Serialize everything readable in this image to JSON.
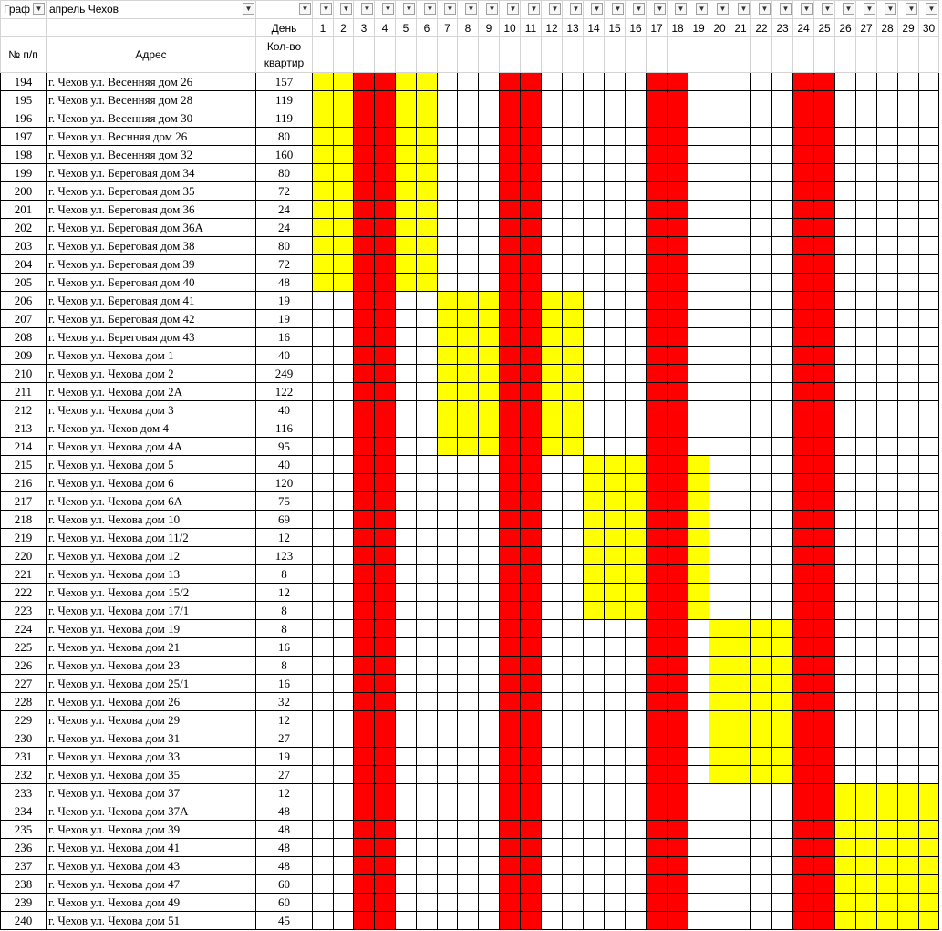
{
  "filter_row": {
    "col_a": "Граф",
    "col_b": "апрель Чехов"
  },
  "header": {
    "den_label": "День",
    "num_label": "№ п/п",
    "address_label": "Адрес",
    "count_label_line1": "Кол-во",
    "count_label_line2": "квартир",
    "days": [
      "1",
      "2",
      "3",
      "4",
      "5",
      "6",
      "7",
      "8",
      "9",
      "10",
      "11",
      "12",
      "13",
      "14",
      "15",
      "16",
      "17",
      "18",
      "19",
      "20",
      "21",
      "22",
      "23",
      "24",
      "25",
      "26",
      "27",
      "28",
      "29",
      "30"
    ]
  },
  "colors": {
    "day_off": "#ff0000",
    "work_day": "#ffff00",
    "empty": "#ffffff"
  },
  "off_days": [
    3,
    4,
    10,
    11,
    17,
    18,
    24,
    25
  ],
  "rows": [
    {
      "n": "194",
      "addr": "г. Чехов ул. Весенняя дом 26",
      "cnt": "157",
      "work": [
        1,
        2,
        5,
        6
      ]
    },
    {
      "n": "195",
      "addr": "г. Чехов ул. Весенняя дом 28",
      "cnt": "119",
      "work": [
        1,
        2,
        5,
        6
      ]
    },
    {
      "n": "196",
      "addr": "г. Чехов ул. Весенняя дом 30",
      "cnt": "119",
      "work": [
        1,
        2,
        5,
        6
      ]
    },
    {
      "n": "197",
      "addr": "г. Чехов ул. Веснняя дом 26",
      "cnt": "80",
      "work": [
        1,
        2,
        5,
        6
      ]
    },
    {
      "n": "198",
      "addr": "г. Чехов ул. Весенняя дом 32",
      "cnt": "160",
      "work": [
        1,
        2,
        5,
        6
      ]
    },
    {
      "n": "199",
      "addr": "г. Чехов ул. Береговая дом 34",
      "cnt": "80",
      "work": [
        1,
        2,
        5,
        6
      ]
    },
    {
      "n": "200",
      "addr": "г. Чехов ул. Береговая дом 35",
      "cnt": "72",
      "work": [
        1,
        2,
        5,
        6
      ]
    },
    {
      "n": "201",
      "addr": "г. Чехов ул. Береговая дом 36",
      "cnt": "24",
      "work": [
        1,
        2,
        5,
        6
      ]
    },
    {
      "n": "202",
      "addr": "г. Чехов ул. Береговая дом 36А",
      "cnt": "24",
      "work": [
        1,
        2,
        5,
        6
      ]
    },
    {
      "n": "203",
      "addr": "г. Чехов ул. Береговая дом 38",
      "cnt": "80",
      "work": [
        1,
        2,
        5,
        6
      ]
    },
    {
      "n": "204",
      "addr": "г. Чехов ул. Береговая дом 39",
      "cnt": "72",
      "work": [
        1,
        2,
        5,
        6
      ]
    },
    {
      "n": "205",
      "addr": "г. Чехов ул. Береговая дом 40",
      "cnt": "48",
      "work": [
        1,
        2,
        5,
        6
      ]
    },
    {
      "n": "206",
      "addr": "г. Чехов ул. Береговая дом 41",
      "cnt": "19",
      "work": [
        7,
        8,
        9,
        12,
        13
      ]
    },
    {
      "n": "207",
      "addr": "г. Чехов ул. Береговая дом 42",
      "cnt": "19",
      "work": [
        7,
        8,
        9,
        12,
        13
      ]
    },
    {
      "n": "208",
      "addr": "г. Чехов ул. Береговая дом 43",
      "cnt": "16",
      "work": [
        7,
        8,
        9,
        12,
        13
      ]
    },
    {
      "n": "209",
      "addr": "г. Чехов ул. Чехова дом 1",
      "cnt": "40",
      "work": [
        7,
        8,
        9,
        12,
        13
      ]
    },
    {
      "n": "210",
      "addr": "г. Чехов ул. Чехова дом 2",
      "cnt": "249",
      "work": [
        7,
        8,
        9,
        12,
        13
      ]
    },
    {
      "n": "211",
      "addr": "г. Чехов ул. Чехова дом 2А",
      "cnt": "122",
      "work": [
        7,
        8,
        9,
        12,
        13
      ]
    },
    {
      "n": "212",
      "addr": "г. Чехов ул. Чехова дом 3",
      "cnt": "40",
      "work": [
        7,
        8,
        9,
        12,
        13
      ]
    },
    {
      "n": "213",
      "addr": "г. Чехов ул. Чехов дом 4",
      "cnt": "116",
      "work": [
        7,
        8,
        9,
        12,
        13
      ]
    },
    {
      "n": "214",
      "addr": "г. Чехов ул. Чехова дом 4А",
      "cnt": "95",
      "work": [
        7,
        8,
        9,
        12,
        13
      ]
    },
    {
      "n": "215",
      "addr": "г. Чехов ул. Чехова дом 5",
      "cnt": "40",
      "work": [
        14,
        15,
        16,
        19
      ]
    },
    {
      "n": "216",
      "addr": "г. Чехов ул. Чехова дом 6",
      "cnt": "120",
      "work": [
        14,
        15,
        16,
        19
      ]
    },
    {
      "n": "217",
      "addr": "г. Чехов ул. Чехова дом 6А",
      "cnt": "75",
      "work": [
        14,
        15,
        16,
        19
      ]
    },
    {
      "n": "218",
      "addr": "г. Чехов ул. Чехова дом 10",
      "cnt": "69",
      "work": [
        14,
        15,
        16,
        19
      ]
    },
    {
      "n": "219",
      "addr": "г. Чехов ул. Чехова дом 11/2",
      "cnt": "12",
      "work": [
        14,
        15,
        16,
        19
      ]
    },
    {
      "n": "220",
      "addr": "г. Чехов ул. Чехова дом 12",
      "cnt": "123",
      "work": [
        14,
        15,
        16,
        19
      ]
    },
    {
      "n": "221",
      "addr": "г. Чехов ул. Чехова дом 13",
      "cnt": "8",
      "work": [
        14,
        15,
        16,
        19
      ]
    },
    {
      "n": "222",
      "addr": "г. Чехов ул. Чехова дом 15/2",
      "cnt": "12",
      "work": [
        14,
        15,
        16,
        19
      ]
    },
    {
      "n": "223",
      "addr": "г. Чехов ул. Чехова дом 17/1",
      "cnt": "8",
      "work": [
        14,
        15,
        16,
        19
      ]
    },
    {
      "n": "224",
      "addr": "г. Чехов ул. Чехова дом 19",
      "cnt": "8",
      "work": [
        20,
        21,
        22,
        23
      ]
    },
    {
      "n": "225",
      "addr": "г. Чехов ул. Чехова дом 21",
      "cnt": "16",
      "work": [
        20,
        21,
        22,
        23
      ]
    },
    {
      "n": "226",
      "addr": "г. Чехов ул. Чехова дом 23",
      "cnt": "8",
      "work": [
        20,
        21,
        22,
        23
      ]
    },
    {
      "n": "227",
      "addr": "г. Чехов ул. Чехова дом 25/1",
      "cnt": "16",
      "work": [
        20,
        21,
        22,
        23
      ]
    },
    {
      "n": "228",
      "addr": "г. Чехов ул. Чехова дом 26",
      "cnt": "32",
      "work": [
        20,
        21,
        22,
        23
      ]
    },
    {
      "n": "229",
      "addr": "г. Чехов ул. Чехова дом 29",
      "cnt": "12",
      "work": [
        20,
        21,
        22,
        23
      ]
    },
    {
      "n": "230",
      "addr": "г. Чехов ул. Чехова дом 31",
      "cnt": "27",
      "work": [
        20,
        21,
        22,
        23
      ]
    },
    {
      "n": "231",
      "addr": "г. Чехов ул. Чехова дом 33",
      "cnt": "19",
      "work": [
        20,
        21,
        22,
        23
      ]
    },
    {
      "n": "232",
      "addr": "г. Чехов ул. Чехова дом 35",
      "cnt": "27",
      "work": [
        20,
        21,
        22,
        23
      ]
    },
    {
      "n": "233",
      "addr": "г. Чехов ул. Чехова дом 37",
      "cnt": "12",
      "work": [
        26,
        27,
        28,
        29,
        30
      ]
    },
    {
      "n": "234",
      "addr": "г. Чехов ул. Чехова дом 37А",
      "cnt": "48",
      "work": [
        26,
        27,
        28,
        29,
        30
      ]
    },
    {
      "n": "235",
      "addr": "г. Чехов ул. Чехова дом 39",
      "cnt": "48",
      "work": [
        26,
        27,
        28,
        29,
        30
      ]
    },
    {
      "n": "236",
      "addr": "г. Чехов ул. Чехова дом 41",
      "cnt": "48",
      "work": [
        26,
        27,
        28,
        29,
        30
      ]
    },
    {
      "n": "237",
      "addr": "г. Чехов ул. Чехова дом 43",
      "cnt": "48",
      "work": [
        26,
        27,
        28,
        29,
        30
      ]
    },
    {
      "n": "238",
      "addr": "г. Чехов ул. Чехова дом 47",
      "cnt": "60",
      "work": [
        26,
        27,
        28,
        29,
        30
      ]
    },
    {
      "n": "239",
      "addr": "г. Чехов ул. Чехова дом 49",
      "cnt": "60",
      "work": [
        26,
        27,
        28,
        29,
        30
      ]
    },
    {
      "n": "240",
      "addr": "г. Чехов ул. Чехова дом 51",
      "cnt": "45",
      "work": [
        26,
        27,
        28,
        29,
        30
      ]
    }
  ]
}
